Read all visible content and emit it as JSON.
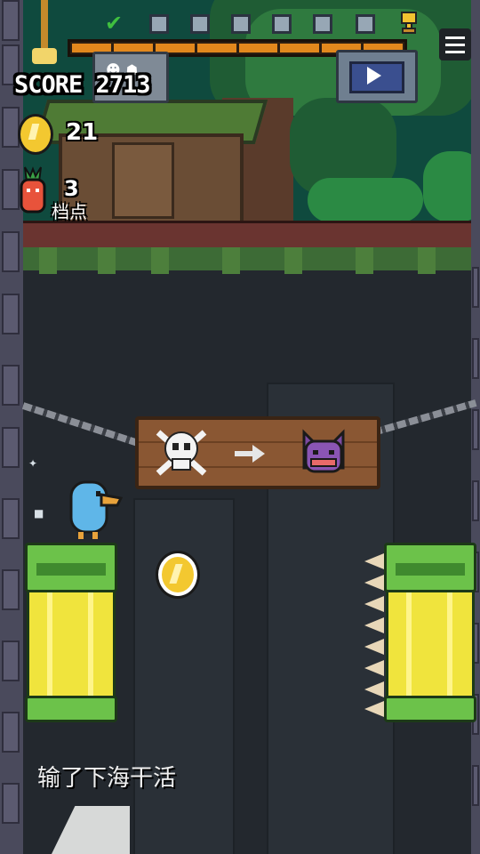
{
  "hud": {
    "score_text": "SCORE 2713",
    "coin_count": "21",
    "carrot_count": "3",
    "checkpoint_label": "档点",
    "progress": {
      "filled_segments": 8,
      "total_segments": 8
    }
  },
  "buttons": {
    "menu": "menu-icon",
    "video": "play-video-icon",
    "ghost": "ghost-shop-icon"
  },
  "sign": {
    "left_icon": "skull-crossbones-icon",
    "middle_icon": "arrow-right-icon",
    "right_icon": "demon-face-icon"
  },
  "caption": {
    "text": "输了下海干活"
  },
  "colors": {
    "accent": "#e2881d",
    "platform_green": "#6cc24a",
    "platform_yellow": "#f0e43d",
    "coin_gold": "#f3c830",
    "bird_blue": "#5fb6e8"
  }
}
